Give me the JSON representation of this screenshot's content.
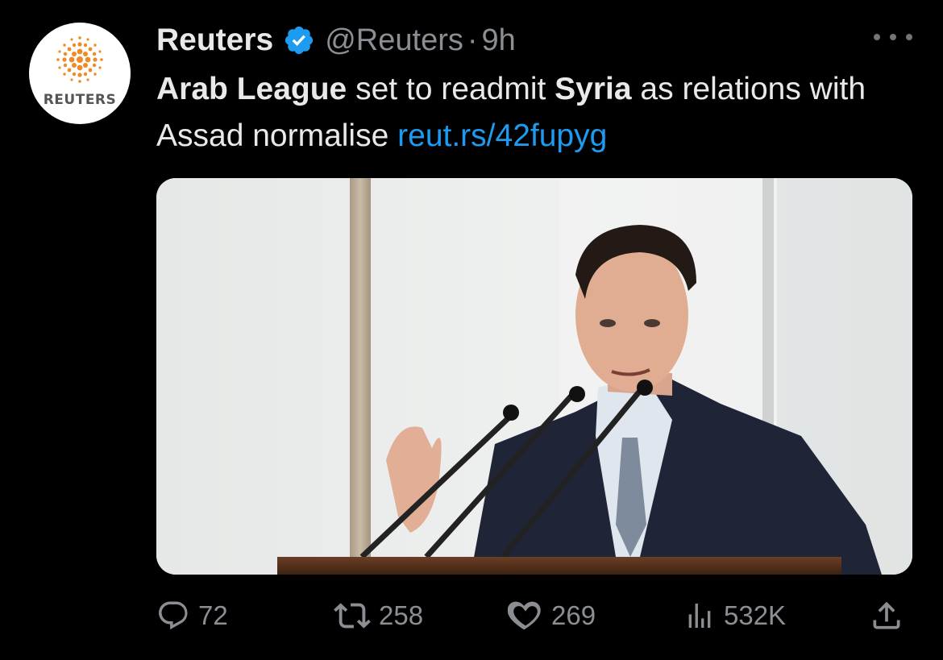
{
  "tweet": {
    "avatar_label": "REUTERS",
    "author_name": "Reuters",
    "verified": true,
    "handle": "@Reuters",
    "separator": "·",
    "time": "9h",
    "text_bold_1": "Arab League",
    "text_1": " set to readmit ",
    "text_bold_2": "Syria",
    "text_2": " as relations with Assad normalise ",
    "link": "reut.rs/42fupyg",
    "media_alt": "Bashar al-Assad speaking at a podium with microphones"
  },
  "actions": {
    "replies": "72",
    "retweets": "258",
    "likes": "269",
    "views": "532K"
  },
  "colors": {
    "background": "#000000",
    "text": "#e7e9ea",
    "muted": "#8b8f94",
    "link": "#1d9bf0",
    "brand_orange": "#f08a24"
  },
  "icons": [
    "reply-icon",
    "retweet-icon",
    "like-icon",
    "views-icon",
    "share-icon",
    "verified-badge-icon",
    "more-icon"
  ]
}
